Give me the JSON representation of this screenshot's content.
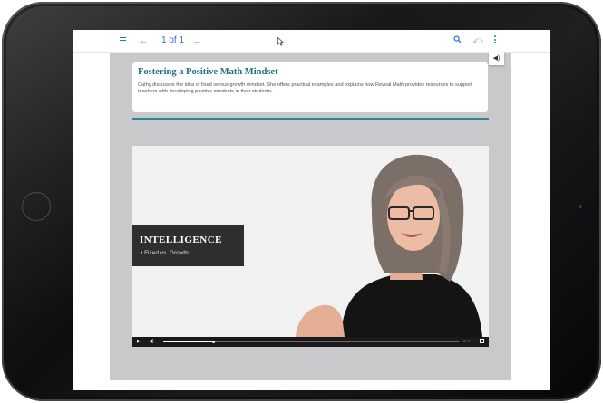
{
  "toolbar": {
    "back_arrow": "←",
    "page_label": "1 of 1",
    "forward_arrow": "→",
    "undo_symbol": "⤺",
    "icons": [
      "menu-icon",
      "search-icon",
      "undo-icon",
      "more-icon",
      "cursor-icon"
    ]
  },
  "lesson": {
    "title": "Fostering a Positive Math Mindset",
    "description": "Cathy discusses the idea of fixed versus growth mindset. She offers practical examples and explains how Reveal Math provides resources to support teachers with developing positive mindsets in their students."
  },
  "audio_button": {
    "symbol": "◀)"
  },
  "video": {
    "caption_title": "INTELLIGENCE",
    "caption_subtitle": "• Fixed vs. Growth",
    "play_symbol": "▶",
    "volume_symbol": "◀)",
    "time_label": "0:??",
    "progress_fraction": 0.17
  },
  "colors": {
    "accent_blue": "#2d6fd3",
    "title_teal": "#1c6f82",
    "rule_teal": "#2a8596",
    "content_gray": "#c9c9cb"
  }
}
